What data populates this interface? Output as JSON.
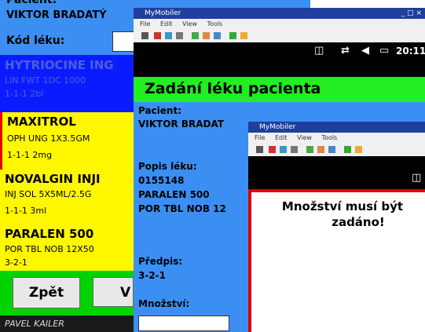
{
  "screen1": {
    "patient_label": "Pacient:",
    "patient_name": "VIKTOR BRADATÝ",
    "code_label": "Kód léku:",
    "code_value": "",
    "drugs": [
      {
        "name": "HYTRIOCINE ING",
        "desc": "LIN FWT 1DC 1000",
        "dose": "1-1-1 2bl",
        "highlight": "blue"
      },
      {
        "name": "MAXITROL",
        "desc": "OPH UNG 1X3.5GM",
        "dose": "1-1-1 2mg",
        "highlight": "yellow"
      },
      {
        "name": "NOVALGIN INJI",
        "desc": "INJ SOL 5X5ML/2.5G",
        "dose": "1-1-1 3ml",
        "highlight": "yellow"
      },
      {
        "name": "PARALEN 500",
        "desc": "POR TBL NOB 12X50",
        "dose": "3-2-1",
        "highlight": "yellow"
      }
    ],
    "back_button": "Zpět",
    "second_button": "V",
    "footer_user": "PAVEL KAILER"
  },
  "screen2": {
    "window_title": "MyMobiler",
    "menu": [
      "File",
      "Edit",
      "View",
      "Tools"
    ],
    "status_time": "20:11",
    "page_title": "Zadání léku pacienta",
    "patient_label": "Pacient:",
    "patient_name": "VIKTOR BRADAT",
    "drug_desc_label": "Popis léku:",
    "drug_code": "0155148",
    "drug_name": "PARALEN 500",
    "drug_form": "POR TBL NOB 12",
    "prescription_label": "Předpis:",
    "prescription_value": "3-2-1",
    "quantity_label": "Množství:",
    "quantity_value": ""
  },
  "screen3": {
    "window_title": "MyMobiler",
    "menu": [
      "File",
      "Edit",
      "View",
      "Tools"
    ],
    "message_line1": "Množství musí být",
    "message_line2": "zadáno!"
  },
  "colors": {
    "blue_bg": "#3b8ff2",
    "green": "#22ee22",
    "yellow": "#fff700",
    "deep_blue": "#0a1cff",
    "red": "#e00000"
  }
}
